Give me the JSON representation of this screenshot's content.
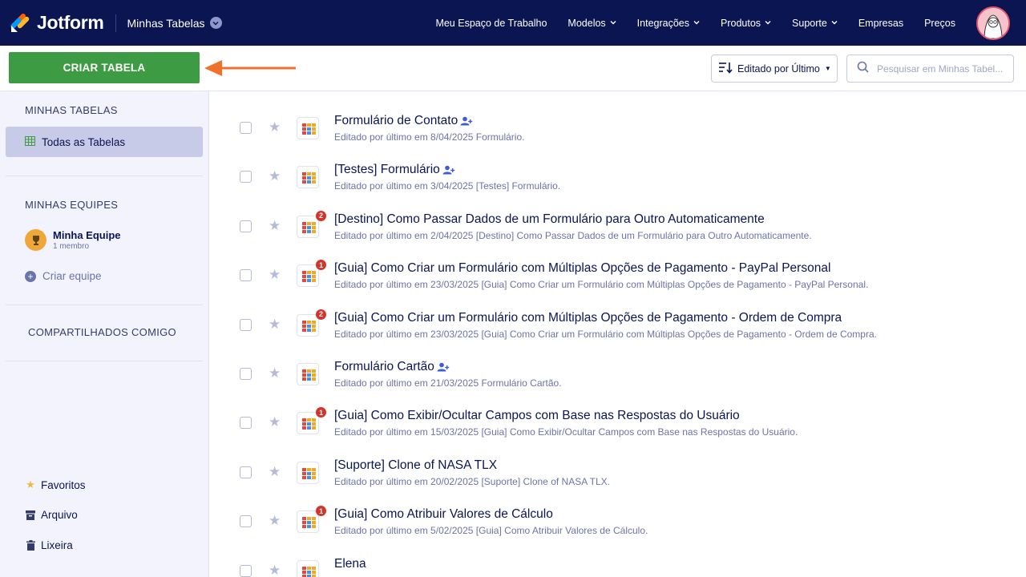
{
  "brand": {
    "name": "Jotform"
  },
  "workspace": {
    "title": "Minhas Tabelas"
  },
  "nav": [
    {
      "label": "Meu Espaço de Trabalho",
      "has_menu": false
    },
    {
      "label": "Modelos",
      "has_menu": true
    },
    {
      "label": "Integrações",
      "has_menu": true
    },
    {
      "label": "Produtos",
      "has_menu": true
    },
    {
      "label": "Suporte",
      "has_menu": true
    },
    {
      "label": "Empresas",
      "has_menu": false
    },
    {
      "label": "Preços",
      "has_menu": false
    }
  ],
  "toolbar": {
    "create_label": "CRIAR TABELA",
    "sort_label": "Editado por Último",
    "search_placeholder": "Pesquisar em Minhas Tabel..."
  },
  "sidebar": {
    "my_tables_title": "MINHAS TABELAS",
    "all_tables_label": "Todas as Tabelas",
    "my_teams_title": "MINHAS EQUIPES",
    "team_name": "Minha Equipe",
    "team_members": "1 membro",
    "create_team_label": "Criar equipe",
    "shared_title": "COMPARTILHADOS COMIGO",
    "favorites_label": "Favoritos",
    "archive_label": "Arquivo",
    "trash_label": "Lixeira"
  },
  "colors": {
    "topbar": "#0a1551",
    "create_button": "#3c9b43",
    "badge": "#d2332b",
    "arrow": "#f0712c"
  },
  "tables": [
    {
      "title": "Formulário de Contato",
      "shared": true,
      "badge": "",
      "edited_label": "Editado por último em 8/04/2025",
      "source": "Formulário."
    },
    {
      "title": "[Testes] Formulário",
      "shared": true,
      "badge": "",
      "edited_label": "Editado por último em 3/04/2025",
      "source": "[Testes] Formulário."
    },
    {
      "title": "[Destino] Como Passar Dados de um Formulário para Outro Automaticamente",
      "shared": false,
      "badge": "2",
      "edited_label": "Editado por último em 2/04/2025",
      "source": "[Destino] Como Passar Dados de um Formulário para Outro Automaticamente."
    },
    {
      "title": "[Guia] Como Criar um Formulário com Múltiplas Opções de Pagamento - PayPal Personal",
      "shared": false,
      "badge": "1",
      "edited_label": "Editado por último em 23/03/2025",
      "source": "[Guia] Como Criar um Formulário com Múltiplas Opções de Pagamento - PayPal Personal."
    },
    {
      "title": "[Guia] Como Criar um Formulário com Múltiplas Opções de Pagamento - Ordem de Compra",
      "shared": false,
      "badge": "2",
      "edited_label": "Editado por último em 23/03/2025",
      "source": "[Guia] Como Criar um Formulário com Múltiplas Opções de Pagamento - Ordem de Compra."
    },
    {
      "title": "Formulário Cartão",
      "shared": true,
      "badge": "",
      "edited_label": "Editado por último em 21/03/2025",
      "source": "Formulário Cartão."
    },
    {
      "title": "[Guia] Como Exibir/Ocultar Campos com Base nas Respostas do Usuário",
      "shared": false,
      "badge": "1",
      "edited_label": "Editado por último em 15/03/2025",
      "source": "[Guia] Como Exibir/Ocultar Campos com Base nas Respostas do Usuário."
    },
    {
      "title": "[Suporte] Clone of NASA TLX",
      "shared": false,
      "badge": "",
      "edited_label": "Editado por último em 20/02/2025",
      "source": "[Suporte] Clone of NASA TLX."
    },
    {
      "title": "[Guia] Como Atribuir Valores de Cálculo",
      "shared": false,
      "badge": "1",
      "edited_label": "Editado por último em 5/02/2025",
      "source": "[Guia] Como Atribuir Valores de Cálculo."
    },
    {
      "title": "Elena",
      "shared": false,
      "badge": "",
      "edited_label": "",
      "source": ""
    }
  ]
}
